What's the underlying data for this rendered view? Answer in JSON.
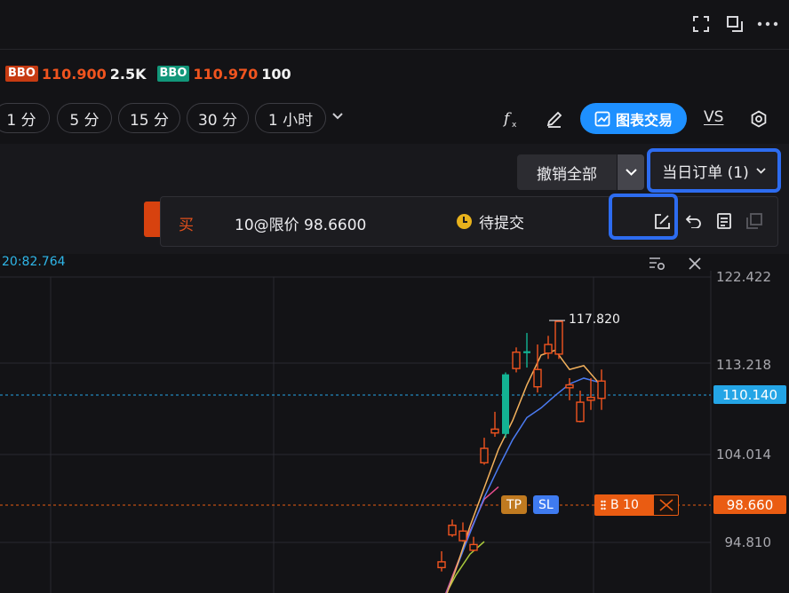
{
  "header": {
    "icons": [
      "fullscreen-icon",
      "popout-icon",
      "more-icon"
    ]
  },
  "quote": {
    "bid_tag": "BBO",
    "bid_price": "110.900",
    "bid_size": "2.5K",
    "ask_tag": "BBO",
    "ask_price": "110.970",
    "ask_size": "100"
  },
  "timeframes": [
    "1 分",
    "5 分",
    "15 分",
    "30 分",
    "1 小时"
  ],
  "toolbar": {
    "indicator_icon": "fx-icon",
    "draw_icon": "pen-icon",
    "chart_trade_label": "图表交易",
    "vs_label": "VS",
    "settings_icon": "settings-icon"
  },
  "orders": {
    "cancel_all_label": "撤销全部",
    "day_orders_label": "当日订单 (1)",
    "card": {
      "side": "买",
      "description": "10@限价 98.6600",
      "status": "待提交"
    }
  },
  "chart": {
    "time_value": "20:82.764",
    "y_labels": [
      "122.422",
      "113.218",
      "104.014",
      "94.810"
    ],
    "last_price": "110.140",
    "order_price": "98.660",
    "peak_label": "117.820",
    "tp_label": "TP",
    "sl_label": "SL",
    "order_tag": "B 10",
    "colors": {
      "up": "#13b393",
      "down": "#f0541f",
      "ma_short": "#f3b15c",
      "ma_mid": "#4b7bf2",
      "ma_long1": "#e94d8f",
      "ma_long2": "#a9c93c",
      "grid": "#2a2a30",
      "last_price_line": "#24a5e6",
      "order_line": "#ea5c12"
    },
    "candles": [
      {
        "o": 92.8,
        "h": 93.9,
        "l": 91.8,
        "c": 92.2
      },
      {
        "o": 96.6,
        "h": 97.2,
        "l": 95.4,
        "c": 95.6
      },
      {
        "o": 96.0,
        "h": 96.9,
        "l": 94.9,
        "c": 95.0
      },
      {
        "o": 94.6,
        "h": 95.4,
        "l": 93.9,
        "c": 94.0
      },
      {
        "o": 104.6,
        "h": 105.7,
        "l": 102.9,
        "c": 103.1
      },
      {
        "o": 106.6,
        "h": 108.4,
        "l": 105.8,
        "c": 106.2
      },
      {
        "o": 106.1,
        "h": 112.5,
        "l": 105.7,
        "c": 112.3
      },
      {
        "o": 114.6,
        "h": 115.1,
        "l": 112.5,
        "c": 112.9
      },
      {
        "o": 114.5,
        "h": 116.6,
        "l": 113.0,
        "c": 114.7
      },
      {
        "o": 112.8,
        "h": 115.4,
        "l": 110.4,
        "c": 111.0
      },
      {
        "o": 115.4,
        "h": 116.3,
        "l": 113.9,
        "c": 114.5
      },
      {
        "o": 117.8,
        "h": 117.8,
        "l": 113.9,
        "c": 114.4
      },
      {
        "o": 111.2,
        "h": 111.9,
        "l": 109.6,
        "c": 110.9
      },
      {
        "o": 109.4,
        "h": 110.6,
        "l": 107.3,
        "c": 107.4
      },
      {
        "o": 109.9,
        "h": 111.9,
        "l": 108.6,
        "c": 109.6
      },
      {
        "o": 111.6,
        "h": 112.8,
        "l": 108.6,
        "c": 109.8
      }
    ],
    "ma_short": [
      88.0,
      92.0,
      96.5,
      100.5,
      104.5,
      107.5,
      111.2,
      114.3,
      114.8,
      112.8,
      113.2,
      111.5
    ],
    "ma_mid": [
      88.2,
      92.0,
      95.8,
      99.5,
      102.6,
      105.5,
      107.8,
      108.8,
      110.1,
      111.3,
      111.9,
      111.5
    ],
    "ma_long1": [
      88.4,
      92.2,
      96.0,
      99.3,
      100.6
    ],
    "ma_long2": [
      88.6,
      91.4,
      93.6,
      94.9
    ]
  }
}
